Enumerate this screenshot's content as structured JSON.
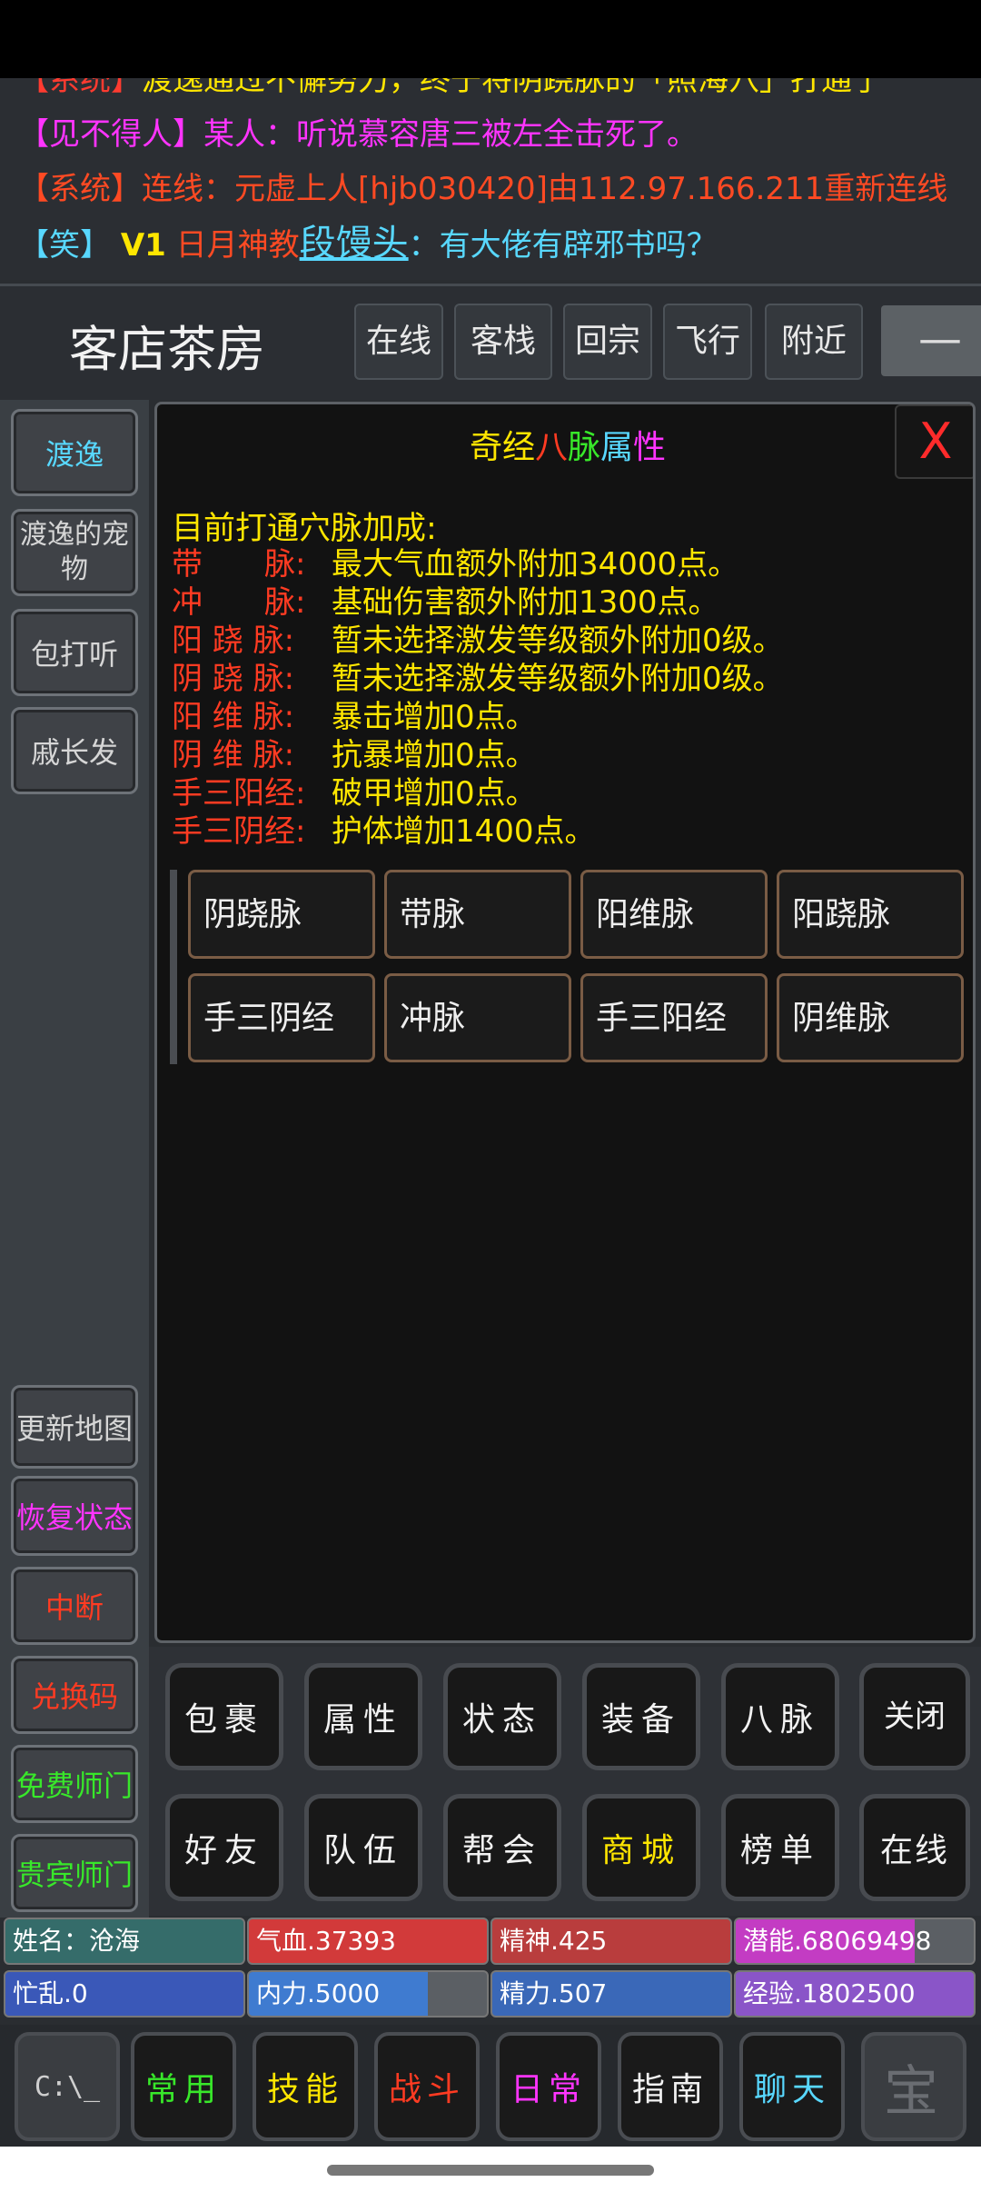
{
  "chat": {
    "line0": {
      "tag": "【系统】",
      "text": "渡逸通过不懈努力，终于将阴跷脉的「照海穴」打通了"
    },
    "line1": {
      "tag": "【见不得人】",
      "speaker": "某人：",
      "text": "听说慕容唐三被左全击死了。"
    },
    "line2": {
      "tag": "【系统】",
      "text": "连线：元虚上人[hjb030420]由112.97.166.211重新连线"
    },
    "line3": {
      "tag": "【笑】",
      "vip": "V1",
      "sect": "日月神教",
      "name": "段馒头",
      "text": "：有大佬有辟邪书吗？"
    }
  },
  "header": {
    "location": "客店茶房",
    "buttons": [
      "在线",
      "客栈",
      "回宗",
      "飞行",
      "附近"
    ],
    "collapse": "—"
  },
  "sidebar": {
    "top": [
      "渡逸",
      "渡逸的宠物",
      "包打听",
      "戚长发"
    ],
    "bottom": [
      "更新地图",
      "恢复状态",
      "中断",
      "兑换码",
      "免费师门",
      "贵宾师门"
    ]
  },
  "panel": {
    "title_parts": [
      "奇经",
      "八",
      "脉",
      "属",
      "性"
    ],
    "close": "X",
    "heading": "目前打通穴脉加成:",
    "bonuses": [
      {
        "label": "带　　脉:",
        "value": "最大气血额外附加34000点。"
      },
      {
        "label": "冲　　脉:",
        "value": "基础伤害额外附加1300点。"
      },
      {
        "label": "阳 跷 脉:",
        "value": "暂未选择激发等级额外附加0级。"
      },
      {
        "label": "阴 跷 脉:",
        "value": "暂未选择激发等级额外附加0级。"
      },
      {
        "label": "阳 维 脉:",
        "value": "暴击增加0点。"
      },
      {
        "label": "阴 维 脉:",
        "value": "抗暴增加0点。"
      },
      {
        "label": "手三阳经:",
        "value": "破甲增加0点。"
      },
      {
        "label": "手三阴经:",
        "value": "护体增加1400点。"
      }
    ],
    "meridians": [
      "阴跷脉",
      "带脉",
      "阳维脉",
      "阳跷脉",
      "手三阴经",
      "冲脉",
      "手三阳经",
      "阴维脉"
    ]
  },
  "actions": {
    "row1": [
      "包裹",
      "属性",
      "状态",
      "装备",
      "八脉",
      "关闭"
    ],
    "row2": [
      "好友",
      "队伍",
      "帮会",
      "商城",
      "榜单",
      "在线"
    ]
  },
  "stats": {
    "name": "姓名：沧海",
    "hp": "气血.37393",
    "spirit": "精神.425",
    "potential": "潜能.68069498",
    "busy": "忙乱.0",
    "neili": "内力.5000",
    "jingli": "精力.507",
    "exp": "经验.1802500",
    "neili_fill_pct": 75,
    "potential_fill_pct": 75
  },
  "nav": {
    "items": [
      "常用",
      "技能",
      "战斗",
      "日常",
      "指南",
      "聊天"
    ],
    "left_icon_text": "C:\\_",
    "right_icon_text": "宝"
  },
  "colors": {
    "title_qi": "#ffe600",
    "title_ba": "#ff3b22",
    "title_mai": "#38e82a",
    "title_shu": "#58d8ff",
    "title_xing": "#ff34ff"
  }
}
